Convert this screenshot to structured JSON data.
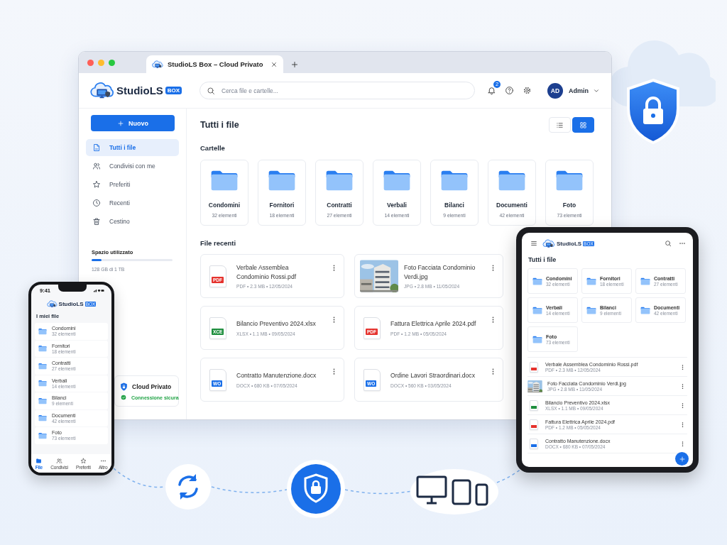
{
  "desktop": {
    "tab_title": "StudioLS Box – Cloud Privato",
    "brand": {
      "name": "StudioLS",
      "badge": "BOX"
    },
    "search": {
      "placeholder": "Cerca file e cartelle..."
    },
    "notification_count": "2",
    "user": {
      "initials": "AD",
      "name": "Admin"
    },
    "new_button": "Nuovo",
    "sidebar_items": [
      {
        "label": "Tutti i file",
        "selected": true
      },
      {
        "label": "Condivisi con me",
        "selected": false
      },
      {
        "label": "Preferiti",
        "selected": false
      },
      {
        "label": "Recenti",
        "selected": false
      },
      {
        "label": "Cestino",
        "selected": false
      }
    ],
    "storage": {
      "label": "Spazio utilizzato",
      "level": 0.12,
      "text": "128 GB di 1 TB"
    },
    "security": {
      "title": "Cloud Privato",
      "status": "Connessione sicura"
    },
    "page_title": "Tutti i file",
    "view_toggle": [
      {
        "kind": "list",
        "selected": false
      },
      {
        "kind": "grid",
        "selected": true
      }
    ],
    "folders_heading": "Cartelle",
    "folders": [
      {
        "name": "Condomini",
        "count": "32 elementi"
      },
      {
        "name": "Fornitori",
        "count": "18 elementi"
      },
      {
        "name": "Contratti",
        "count": "27 elementi"
      },
      {
        "name": "Verbali",
        "count": "14 elementi"
      },
      {
        "name": "Bilanci",
        "count": "9 elementi"
      },
      {
        "name": "Documenti",
        "count": "42 elementi"
      },
      {
        "name": "Foto",
        "count": "73 elementi"
      }
    ],
    "recent_heading": "File recenti",
    "recent_files": [
      {
        "kind": "pdf",
        "badge": "PDF",
        "name": "Verbale Assemblea Condominio Rossi.pdf",
        "meta": "PDF • 2.3 MB • 12/05/2024"
      },
      {
        "name": "Foto Facciata Condominio Verdi.jpg",
        "meta": "JPG • 2.8 MB • 11/05/2024"
      },
      {
        "kind": "xlsx",
        "badge": "XCE",
        "name": "Bilancio Preventivo 2024.xlsx",
        "meta": "XLSX • 1.1 MB • 09/05/2024"
      },
      {
        "kind": "pdf",
        "badge": "PDF",
        "name": "Fattura Elettrica Aprile 2024.pdf",
        "meta": "PDF • 1.2 MB • 05/05/2024"
      },
      {
        "kind": "docx",
        "badge": "WO",
        "name": "Contratto Manutenzione.docx",
        "meta": "DOCX • 680 KB • 07/05/2024"
      },
      {
        "kind": "docx",
        "badge": "WO",
        "name": "Ordine Lavori Straordinari.docx",
        "meta": "DOCX • 560 KB • 03/05/2024"
      }
    ]
  },
  "phone": {
    "time": "9:41",
    "brand": {
      "name": "StudioLS",
      "badge": "BOX"
    },
    "title": "I miei file",
    "folders": [
      {
        "name": "Condomini",
        "count": "32 elementi"
      },
      {
        "name": "Fornitori",
        "count": "18 elementi"
      },
      {
        "name": "Contratti",
        "count": "27 elementi"
      },
      {
        "name": "Verbali",
        "count": "14 elementi"
      },
      {
        "name": "Bilanci",
        "count": "9 elementi"
      },
      {
        "name": "Documenti",
        "count": "42 elementi"
      },
      {
        "name": "Foto",
        "count": "73 elementi"
      }
    ],
    "nav": [
      {
        "label": "File",
        "selected": true
      },
      {
        "label": "Condivisi",
        "selected": false
      },
      {
        "label": "Preferiti",
        "selected": false
      },
      {
        "label": "Altro",
        "selected": false
      }
    ]
  },
  "tablet": {
    "brand": {
      "name": "StudioLS",
      "badge": "BOX"
    },
    "title": "Tutti i file",
    "folders": [
      {
        "name": "Condomini",
        "count": "32 elementi"
      },
      {
        "name": "Fornitori",
        "count": "18 elementi"
      },
      {
        "name": "Contratti",
        "count": "27 elementi"
      },
      {
        "name": "Verbali",
        "count": "14 elementi"
      },
      {
        "name": "Bilanci",
        "count": "9 elementi"
      },
      {
        "name": "Documenti",
        "count": "42 elementi"
      },
      {
        "name": "Foto",
        "count": "73 elementi"
      }
    ],
    "files": [
      {
        "kind": "pdf",
        "name": "Verbale Assemblea Condominio Rossi.pdf",
        "meta": "PDF • 2.3 MB • 12/05/2024"
      },
      {
        "name": "Foto Facciata Condominio Verdi.jpg",
        "meta": "JPG • 2.8 MB • 11/05/2024"
      },
      {
        "kind": "xlsx",
        "name": "Bilancio Preventivo 2024.xlsx",
        "meta": "XLSX • 1.1 MB • 09/05/2024"
      },
      {
        "kind": "pdf",
        "name": "Fattura Elettrica Aprile 2024.pdf",
        "meta": "PDF • 1.2 MB • 05/05/2024"
      },
      {
        "kind": "docx",
        "name": "Contratto Manutenzione.docx",
        "meta": "DOCX • 680 KB • 07/05/2024"
      }
    ]
  }
}
